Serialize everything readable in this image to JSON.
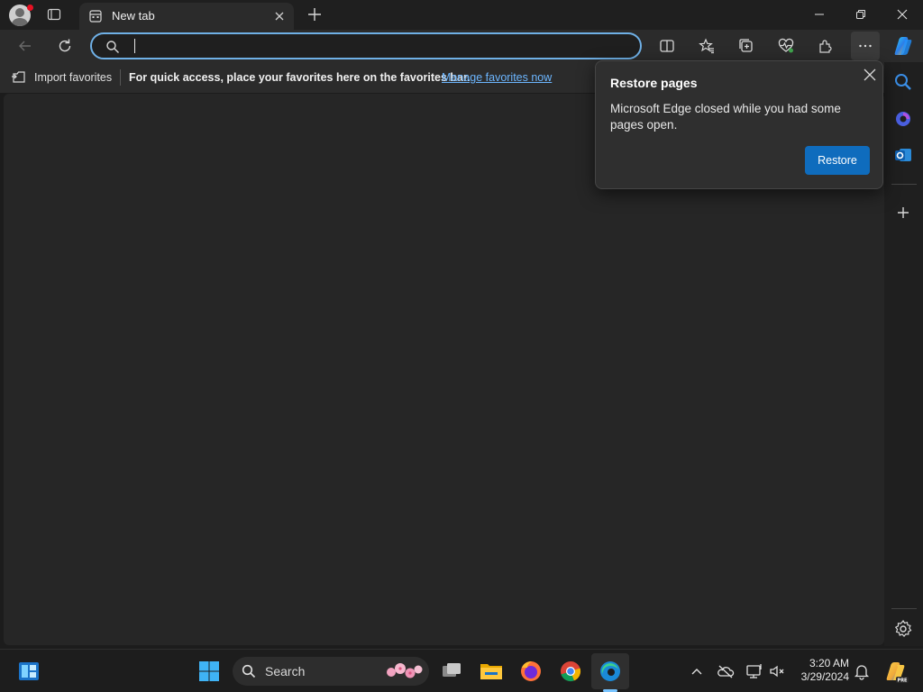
{
  "browser": {
    "tab_title": "New tab",
    "address_value": "",
    "address_placeholder": ""
  },
  "favorites_bar": {
    "import_label": "Import favorites",
    "message": "For quick access, place your favorites here on the favorites bar.",
    "link": "Manage favorites now"
  },
  "restore_popup": {
    "title": "Restore pages",
    "message": "Microsoft Edge closed while you had some pages open.",
    "button": "Restore"
  },
  "taskbar": {
    "search_label": "Search",
    "time": "3:20 AM",
    "date": "3/29/2024"
  },
  "colors": {
    "accent": "#0f6cbd",
    "address_border": "#6fb0e6",
    "link": "#6cb6ff"
  },
  "icons": [
    "profile-icon",
    "tab-actions-icon",
    "new-tab-page-icon",
    "close-icon",
    "plus-icon",
    "minimize-icon",
    "restore-icon",
    "back-icon",
    "refresh-icon",
    "search-icon",
    "split-screen-icon",
    "favorites-icon",
    "collections-icon",
    "browser-essentials-icon",
    "extensions-icon",
    "more-icon",
    "copilot-icon",
    "outlook-icon",
    "settings-icon",
    "windows-icon",
    "widgets-icon",
    "task-view-icon",
    "file-explorer-icon",
    "firefox-icon",
    "chrome-icon",
    "edge-icon",
    "chevron-up-icon",
    "onedrive-icon",
    "display-icon",
    "volume-icon",
    "notification-icon"
  ]
}
